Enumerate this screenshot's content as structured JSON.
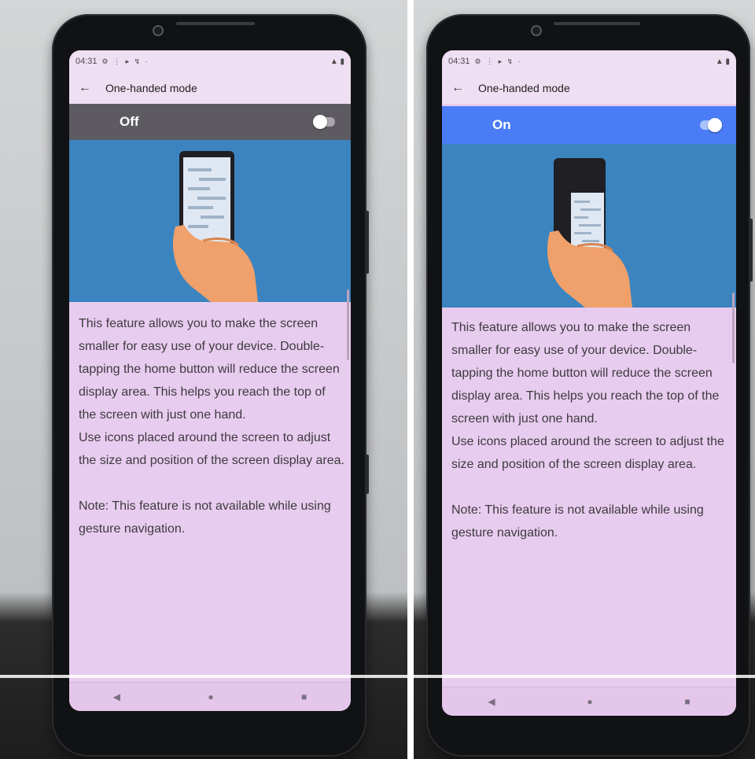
{
  "panels": [
    {
      "status_time": "04:31",
      "status_icons": "⚙ ⋮ ▸ ↯ ·",
      "status_right": "▲ ▮",
      "title": "One-handed mode",
      "toggle_label": "Off",
      "toggle_state": false,
      "body_text": "This feature allows you to make the screen smaller for easy use of your device. Double-tapping the home button will reduce the screen display area. This helps you reach the top of the screen with just one hand.",
      "body_text_2": "Use icons placed around the screen to adjust the size and position of the screen display area.",
      "note": "Note: This feature is not available while using gesture navigation.",
      "nav": {
        "back": "◀",
        "home": "●",
        "recents": "■"
      }
    },
    {
      "status_time": "04:31",
      "status_icons": "⚙ ⋮ ▸ ↯ ·",
      "status_right": "▲ ▮",
      "title": "One-handed mode",
      "toggle_label": "On",
      "toggle_state": true,
      "body_text": "This feature allows you to make the screen smaller for easy use of your device. Double-tapping the home button will reduce the screen display area. This helps you reach the top of the screen with just one hand.",
      "body_text_2": "Use icons placed around the screen to adjust the size and position of the screen display area.",
      "note": "Note: This feature is not available while using gesture navigation.",
      "nav": {
        "back": "◀",
        "home": "●",
        "recents": "■"
      }
    }
  ],
  "colors": {
    "toggle_off_bar": "#5d5b61",
    "toggle_on_bar": "#4a7cf6",
    "illustration_bg": "#3b84bf",
    "screen_bg": "#e8ccef"
  },
  "icons": {
    "back_arrow": "←"
  }
}
